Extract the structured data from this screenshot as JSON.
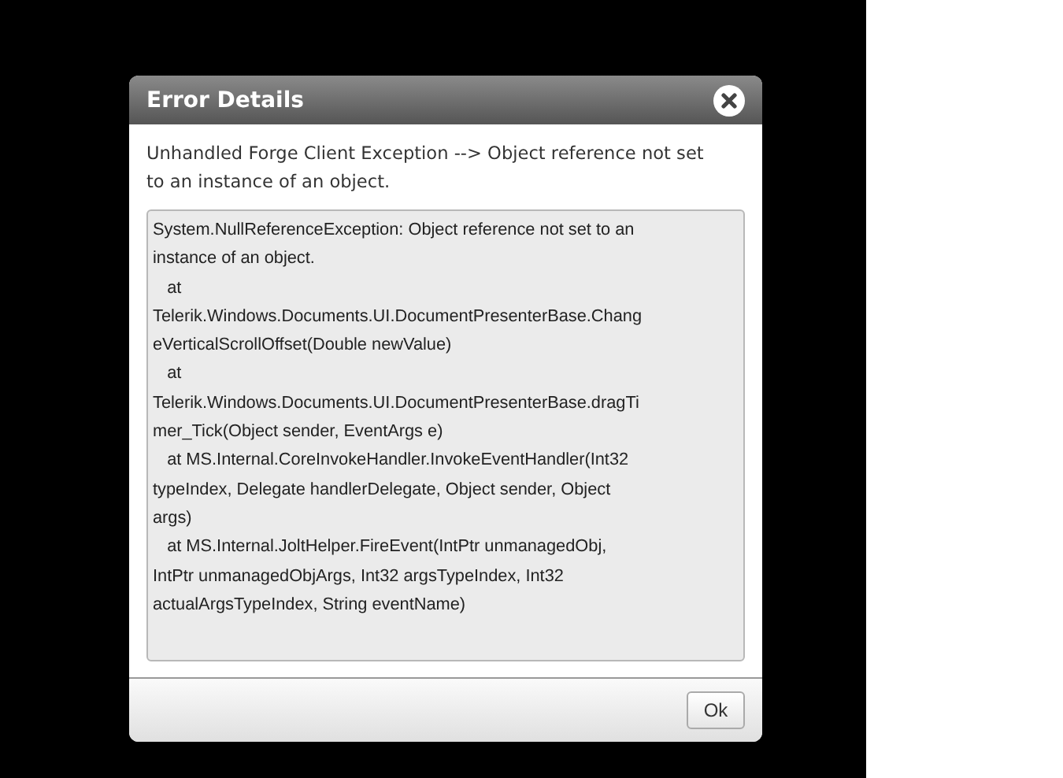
{
  "dialog": {
    "title": "Error Details",
    "message_lines": [
      "Unhandled Forge Client Exception --> Object reference not set",
      "to an instance of an object."
    ],
    "details_lines": [
      "System.NullReferenceException: Object reference not set to an",
      "instance of an object.",
      "   at",
      "Telerik.Windows.Documents.UI.DocumentPresenterBase.Chang",
      "eVerticalScrollOffset(Double newValue)",
      "   at",
      "Telerik.Windows.Documents.UI.DocumentPresenterBase.dragTi",
      "mer_Tick(Object sender, EventArgs e)",
      "   at MS.Internal.CoreInvokeHandler.InvokeEventHandler(Int32",
      "typeIndex, Delegate handlerDelegate, Object sender, Object",
      "args)",
      "   at MS.Internal.JoltHelper.FireEvent(IntPtr unmanagedObj,",
      "IntPtr unmanagedObjArgs, Int32 argsTypeIndex, Int32",
      "actualArgsTypeIndex, String eventName)"
    ],
    "buttons": [
      "Ok"
    ]
  }
}
